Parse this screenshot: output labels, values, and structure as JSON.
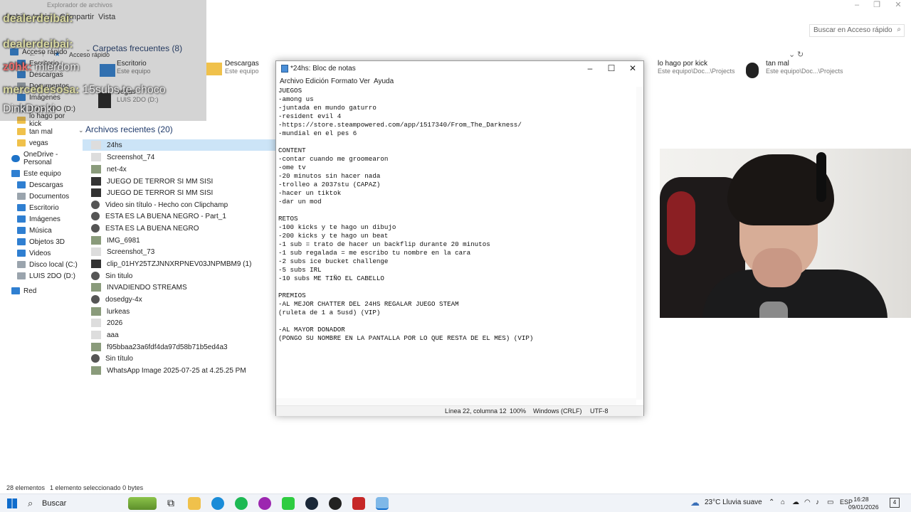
{
  "explorer": {
    "titlebar_text": "Explorador de archivos",
    "ribbon": [
      "Archivo",
      "Inicio",
      "Compartir",
      "Vista"
    ],
    "address": "Acceso rápido",
    "search_placeholder": "Buscar en Acceso rápido",
    "nav": [
      {
        "label": "Acceso rápido",
        "icon": "star-icon"
      },
      {
        "label": "Escritorio",
        "icon": "folder-icon"
      },
      {
        "label": "Descargas",
        "icon": "download-icon"
      },
      {
        "label": "Documentos",
        "icon": "folder-icon"
      },
      {
        "label": "Imágenes",
        "icon": "folder-icon"
      },
      {
        "label": "LUIS 2DO (D:)",
        "icon": "drive-icon"
      },
      {
        "label": "lo hago por kick",
        "icon": "folder-icon"
      },
      {
        "label": "tan mal",
        "icon": "folder-icon"
      },
      {
        "label": "vegas",
        "icon": "folder-icon"
      },
      {
        "label": "OneDrive - Personal",
        "icon": "cloud-icon"
      },
      {
        "label": "Este equipo",
        "icon": "computer-icon"
      },
      {
        "label": "Descargas",
        "icon": "download-icon"
      },
      {
        "label": "Documentos",
        "icon": "folder-icon"
      },
      {
        "label": "Escritorio",
        "icon": "folder-icon"
      },
      {
        "label": "Imágenes",
        "icon": "folder-icon"
      },
      {
        "label": "Música",
        "icon": "music-icon"
      },
      {
        "label": "Objetos 3D",
        "icon": "cube-icon"
      },
      {
        "label": "Videos",
        "icon": "video-icon"
      },
      {
        "label": "Disco local (C:)",
        "icon": "drive-icon"
      },
      {
        "label": "LUIS 2DO (D:)",
        "icon": "drive-icon"
      },
      {
        "label": "Red",
        "icon": "network-icon"
      }
    ],
    "quick_header": "Carpetas frecuentes (8)",
    "quick_tiles": [
      {
        "name": "Escritorio",
        "sub": "Este equipo"
      },
      {
        "name": "Descargas",
        "sub": "Este equipo"
      },
      {
        "name": "lo hago por kick",
        "sub": "Este equipo\\Doc...\\Projects"
      },
      {
        "name": "tan mal",
        "sub": "Este equipo\\Doc...\\Projects"
      },
      {
        "name": "vegas",
        "sub": "LUIS 2DO (D:)"
      }
    ],
    "recent_header": "Archivos recientes (20)",
    "recent": [
      "24hs",
      "Screenshot_74",
      "net-4x",
      "JUEGO DE TERROR SI MM SISI",
      "JUEGO DE TERROR SI MM SISI",
      "Video sin título - Hecho con Clipchamp",
      "ESTA ES LA BUENA NEGRO - Part_1",
      "ESTA ES LA BUENA NEGRO",
      "IMG_6981",
      "Screenshot_73",
      "clip_01HY25TZJNNXRPNEV03JNPMBM9 (1)",
      "Sin titulo",
      "INVADIENDO STREAMS",
      "dosedgy-4x",
      "lurkeas",
      "2026",
      "aaa",
      "f95bbaa23a6fdf4da97d58b71b5ed4a3",
      "Sin título",
      "WhatsApp Image 2025-07-25 at 4.25.25 PM"
    ],
    "status_count": "28 elementos",
    "status_selected": "1 elemento seleccionado 0 bytes"
  },
  "chat": [
    {
      "user": "dealerdeibai:",
      "msg": ""
    },
    {
      "user": "dealerdeibai:",
      "msg": ""
    },
    {
      "user": "z0hk:",
      "msg": "mierdom"
    },
    {
      "user": "mercedesosa:",
      "msg": "15subs te choco"
    },
    {
      "user": "DinkDonki",
      "msg": ""
    }
  ],
  "notepad": {
    "title": "*24hs: Bloc de notas",
    "menu": [
      "Archivo",
      "Edición",
      "Formato",
      "Ver",
      "Ayuda"
    ],
    "text": "JUEGOS\n-among us\n-juntada en mundo gaturro\n-resident evil 4\n-https://store.steampowered.com/app/1517340/From_The_Darkness/\n-mundial en el pes 6\n\nCONTENT\n-contar cuando me groomearon\n-ome tv\n-20 minutos sin hacer nada\n-trolleo a 2037stu (CAPAZ)\n-hacer un tiktok\n-dar un mod\n\nRETOS\n-100 kicks y te hago un dibujo\n-200 kicks y te hago un beat\n-1 sub = trato de hacer un backflip durante 20 minutos\n-1 sub regalada = me escribo tu nombre en la cara\n-2 subs ice bucket challenge\n-5 subs IRL\n-10 subs ME TIÑO EL CABELLO\n\nPREMIOS\n-AL MEJOR CHATTER DEL 24HS REGALAR JUEGO STEAM\n(ruleta de 1 a 5usd) (VIP)\n\n-AL MAYOR DONADOR\n(PONGO SU NOMBRE EN LA PANTALLA POR LO QUE RESTA DE EL MES) (VIP)",
    "status_pos": "Línea 22, columna 12",
    "status_zoom": "100%",
    "status_eol": "Windows (CRLF)",
    "status_enc": "UTF-8"
  },
  "taskbar": {
    "search_label": "Buscar",
    "weather": "23°C  Lluvia suave",
    "lang": "ESP",
    "time": "16:28",
    "date": "09/01/2026",
    "notif_count": "4"
  }
}
